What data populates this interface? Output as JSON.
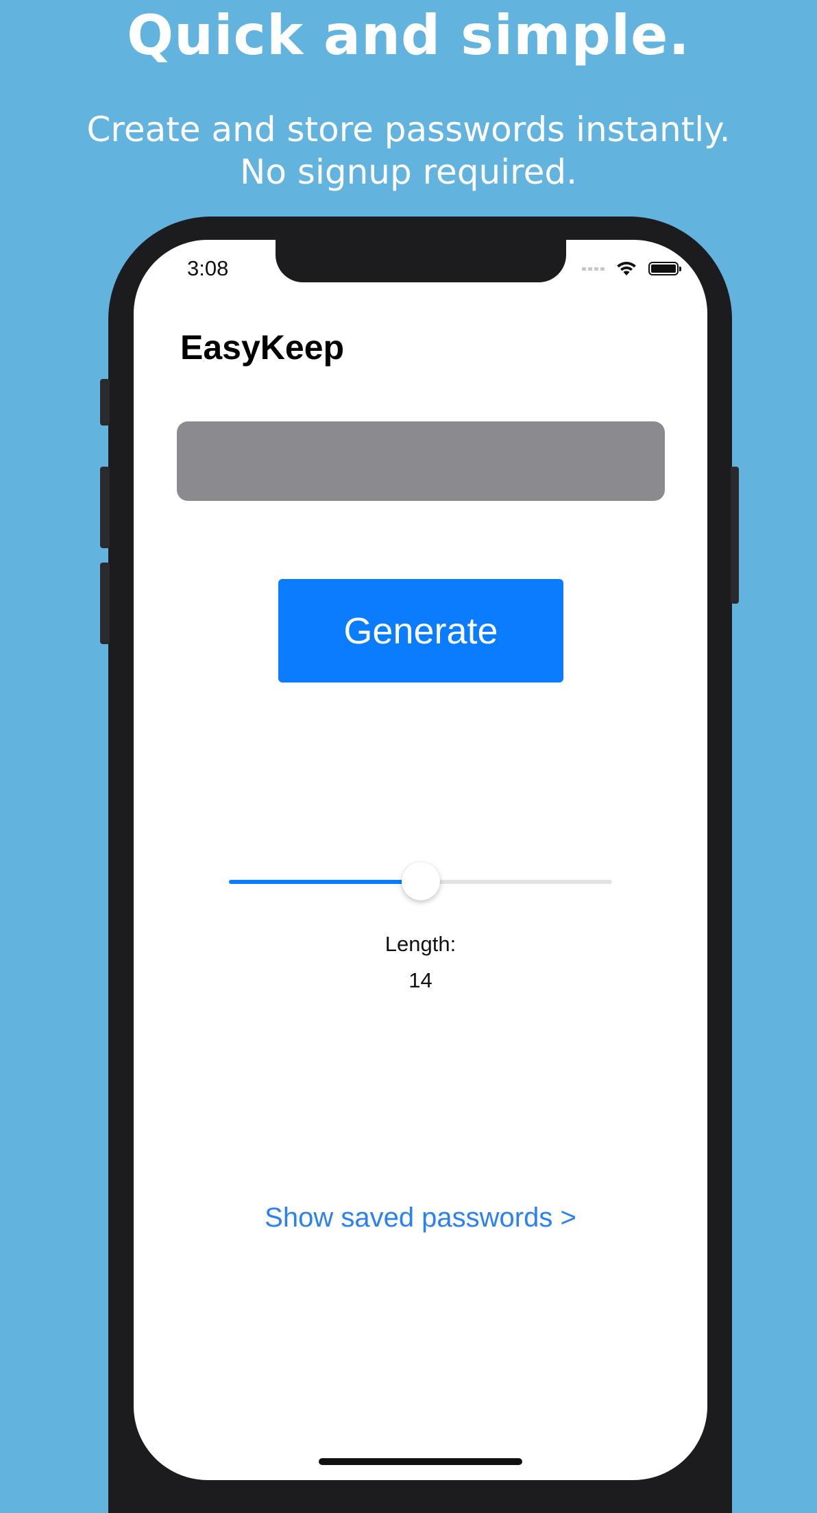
{
  "promo": {
    "headline": "Quick and simple.",
    "subline": [
      "Create and store passwords instantly.",
      "No signup required."
    ]
  },
  "status_bar": {
    "time": "3:08",
    "icons": [
      "signal-dots-icon",
      "wifi-icon",
      "battery-icon"
    ]
  },
  "app": {
    "title": "EasyKeep",
    "password_field": {
      "value": "",
      "placeholder": ""
    },
    "generate_button": "Generate",
    "length_slider": {
      "fraction": 0.5
    },
    "length_label": "Length:",
    "length_value": "14",
    "saved_link": "Show saved passwords >"
  },
  "colors": {
    "background": "#63b3df",
    "accent": "#0a7cff",
    "link": "#2b80f3",
    "field": "#8a8a8f"
  }
}
